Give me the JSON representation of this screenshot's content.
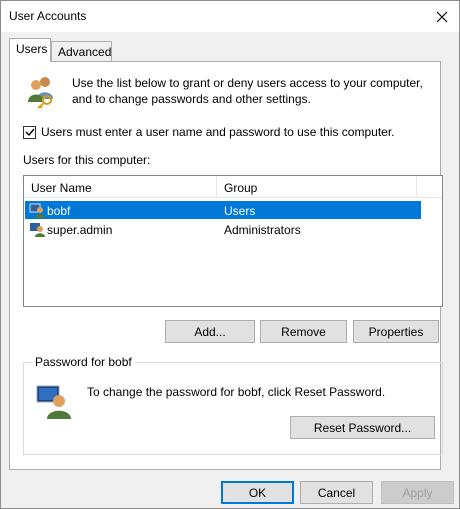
{
  "window": {
    "title": "User Accounts"
  },
  "tabs": [
    {
      "label": "Users",
      "selected": true
    },
    {
      "label": "Advanced",
      "selected": false
    }
  ],
  "users_tab": {
    "intro_text": "Use the list below to grant or deny users access to your computer, and to change passwords and other settings.",
    "must_login_checkbox": {
      "label": "Users must enter a user name and password to use this computer.",
      "checked": true
    },
    "list_caption": "Users for this computer:",
    "list_columns": [
      "User Name",
      "Group"
    ],
    "users": [
      {
        "name": "bobf",
        "group": "Users",
        "selected": true
      },
      {
        "name": "super.admin",
        "group": "Administrators",
        "selected": false
      }
    ],
    "buttons": {
      "add": "Add...",
      "remove": "Remove",
      "properties": "Properties"
    },
    "password_group": {
      "title": "Password for bobf",
      "text": "To change the password for bobf, click Reset Password.",
      "reset_button": "Reset Password..."
    }
  },
  "dialog_buttons": {
    "ok": "OK",
    "cancel": "Cancel",
    "apply": "Apply"
  },
  "colors": {
    "selection": "#0078d7",
    "dialog_bg": "#f0f0f0"
  },
  "icons": {
    "intro": "users-key-icon",
    "row": "user-computer-icon",
    "password": "user-monitor-icon",
    "close": "close-icon"
  }
}
